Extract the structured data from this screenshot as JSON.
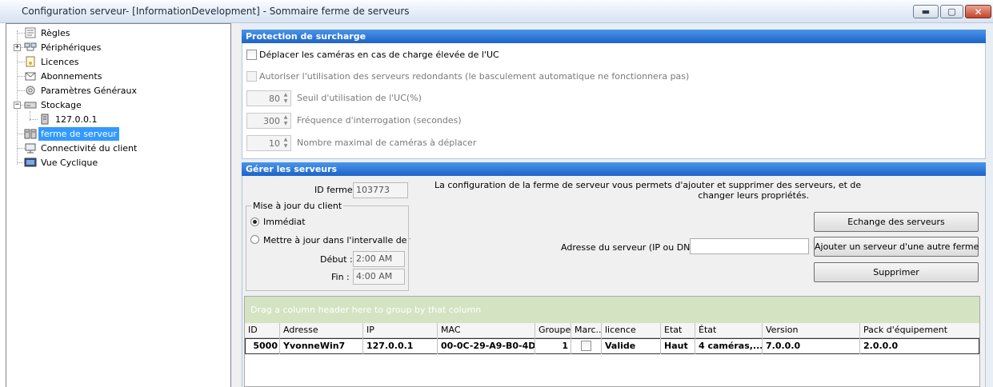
{
  "window": {
    "title": "Configuration serveur- [InformationDevelopment] - Sommaire ferme de serveurs",
    "minimize_icon": "minimize-icon",
    "maximize_icon": "maximize-icon",
    "close_icon": "close-icon"
  },
  "tree": {
    "items": [
      {
        "label": "Règles",
        "icon": "rules-icon"
      },
      {
        "label": "Périphériques",
        "icon": "devices-icon",
        "expander": "+"
      },
      {
        "label": "Licences",
        "icon": "license-icon"
      },
      {
        "label": "Abonnements",
        "icon": "subscriptions-icon"
      },
      {
        "label": "Paramètres Généraux",
        "icon": "general-settings-icon"
      },
      {
        "label": "Stockage",
        "icon": "storage-icon",
        "expander": "−"
      },
      {
        "label": "127.0.0.1",
        "icon": "server-icon"
      },
      {
        "label": "ferme de serveur",
        "icon": "server-farm-icon",
        "selected": true
      },
      {
        "label": "Connectivité du client",
        "icon": "client-connectivity-icon"
      },
      {
        "label": "Vue Cyclique",
        "icon": "cyclic-view-icon"
      }
    ]
  },
  "overload": {
    "header": "Protection de surcharge",
    "move_cameras_label": "Déplacer les caméras en cas de charge élevée de l'UC",
    "move_cameras_checked": false,
    "redundant_label": "Autoriser l'utilisation des serveurs redondants (le basculement automatique ne fonctionnera pas)",
    "redundant_checked": false,
    "cpu_threshold_value": "80",
    "cpu_threshold_label": "Seuil d'utilisation de l'UC(%)",
    "polling_value": "300",
    "polling_label": "Fréquence d'interrogation (secondes)",
    "max_cameras_value": "10",
    "max_cameras_label": "Nombre maximal de caméras à déplacer"
  },
  "manage": {
    "header": "Gérer les serveurs",
    "id_label": "ID ferme",
    "id_value": "103773",
    "info_line1": "La configuration de la ferme de serveur vous permets d'ajouter et supprimer des serveurs, et de",
    "info_line2": "changer leurs propriétés.",
    "client_update_legend": "Mise à jour du client",
    "immediate_label": "Immédiat",
    "immediate_selected": true,
    "interval_label": "Mettre à jour dans l'intervalle de tem",
    "interval_selected": false,
    "start_label": "Début :",
    "start_value": "2:00 AM",
    "end_label": "Fin :",
    "end_value": "4:00 AM",
    "address_label": "Adresse du serveur (IP ou DNS)",
    "address_value": "",
    "swap_button": "Echange des serveurs",
    "add_button": "Ajouter un serveur d'une autre ferme",
    "delete_button": "Supprimer"
  },
  "grid": {
    "group_hint": "Drag a column header here to group by that column",
    "columns": [
      "ID",
      "Adresse",
      "IP",
      "MAC",
      "Groupe",
      "Marc...",
      "licence",
      "Etat",
      "État",
      "Version",
      "Pack d'équipement"
    ],
    "rows": [
      {
        "id": "5000",
        "adresse": "YvonneWin7",
        "ip": "127.0.0.1",
        "mac": "00-0C-29-A9-B0-4D",
        "groupe": "1",
        "marc_checked": false,
        "licence": "Valide",
        "etat": "Haut",
        "etat2": "4 caméras,...",
        "version": "7.0.0.0",
        "pack": "2.0.0.0"
      }
    ]
  }
}
